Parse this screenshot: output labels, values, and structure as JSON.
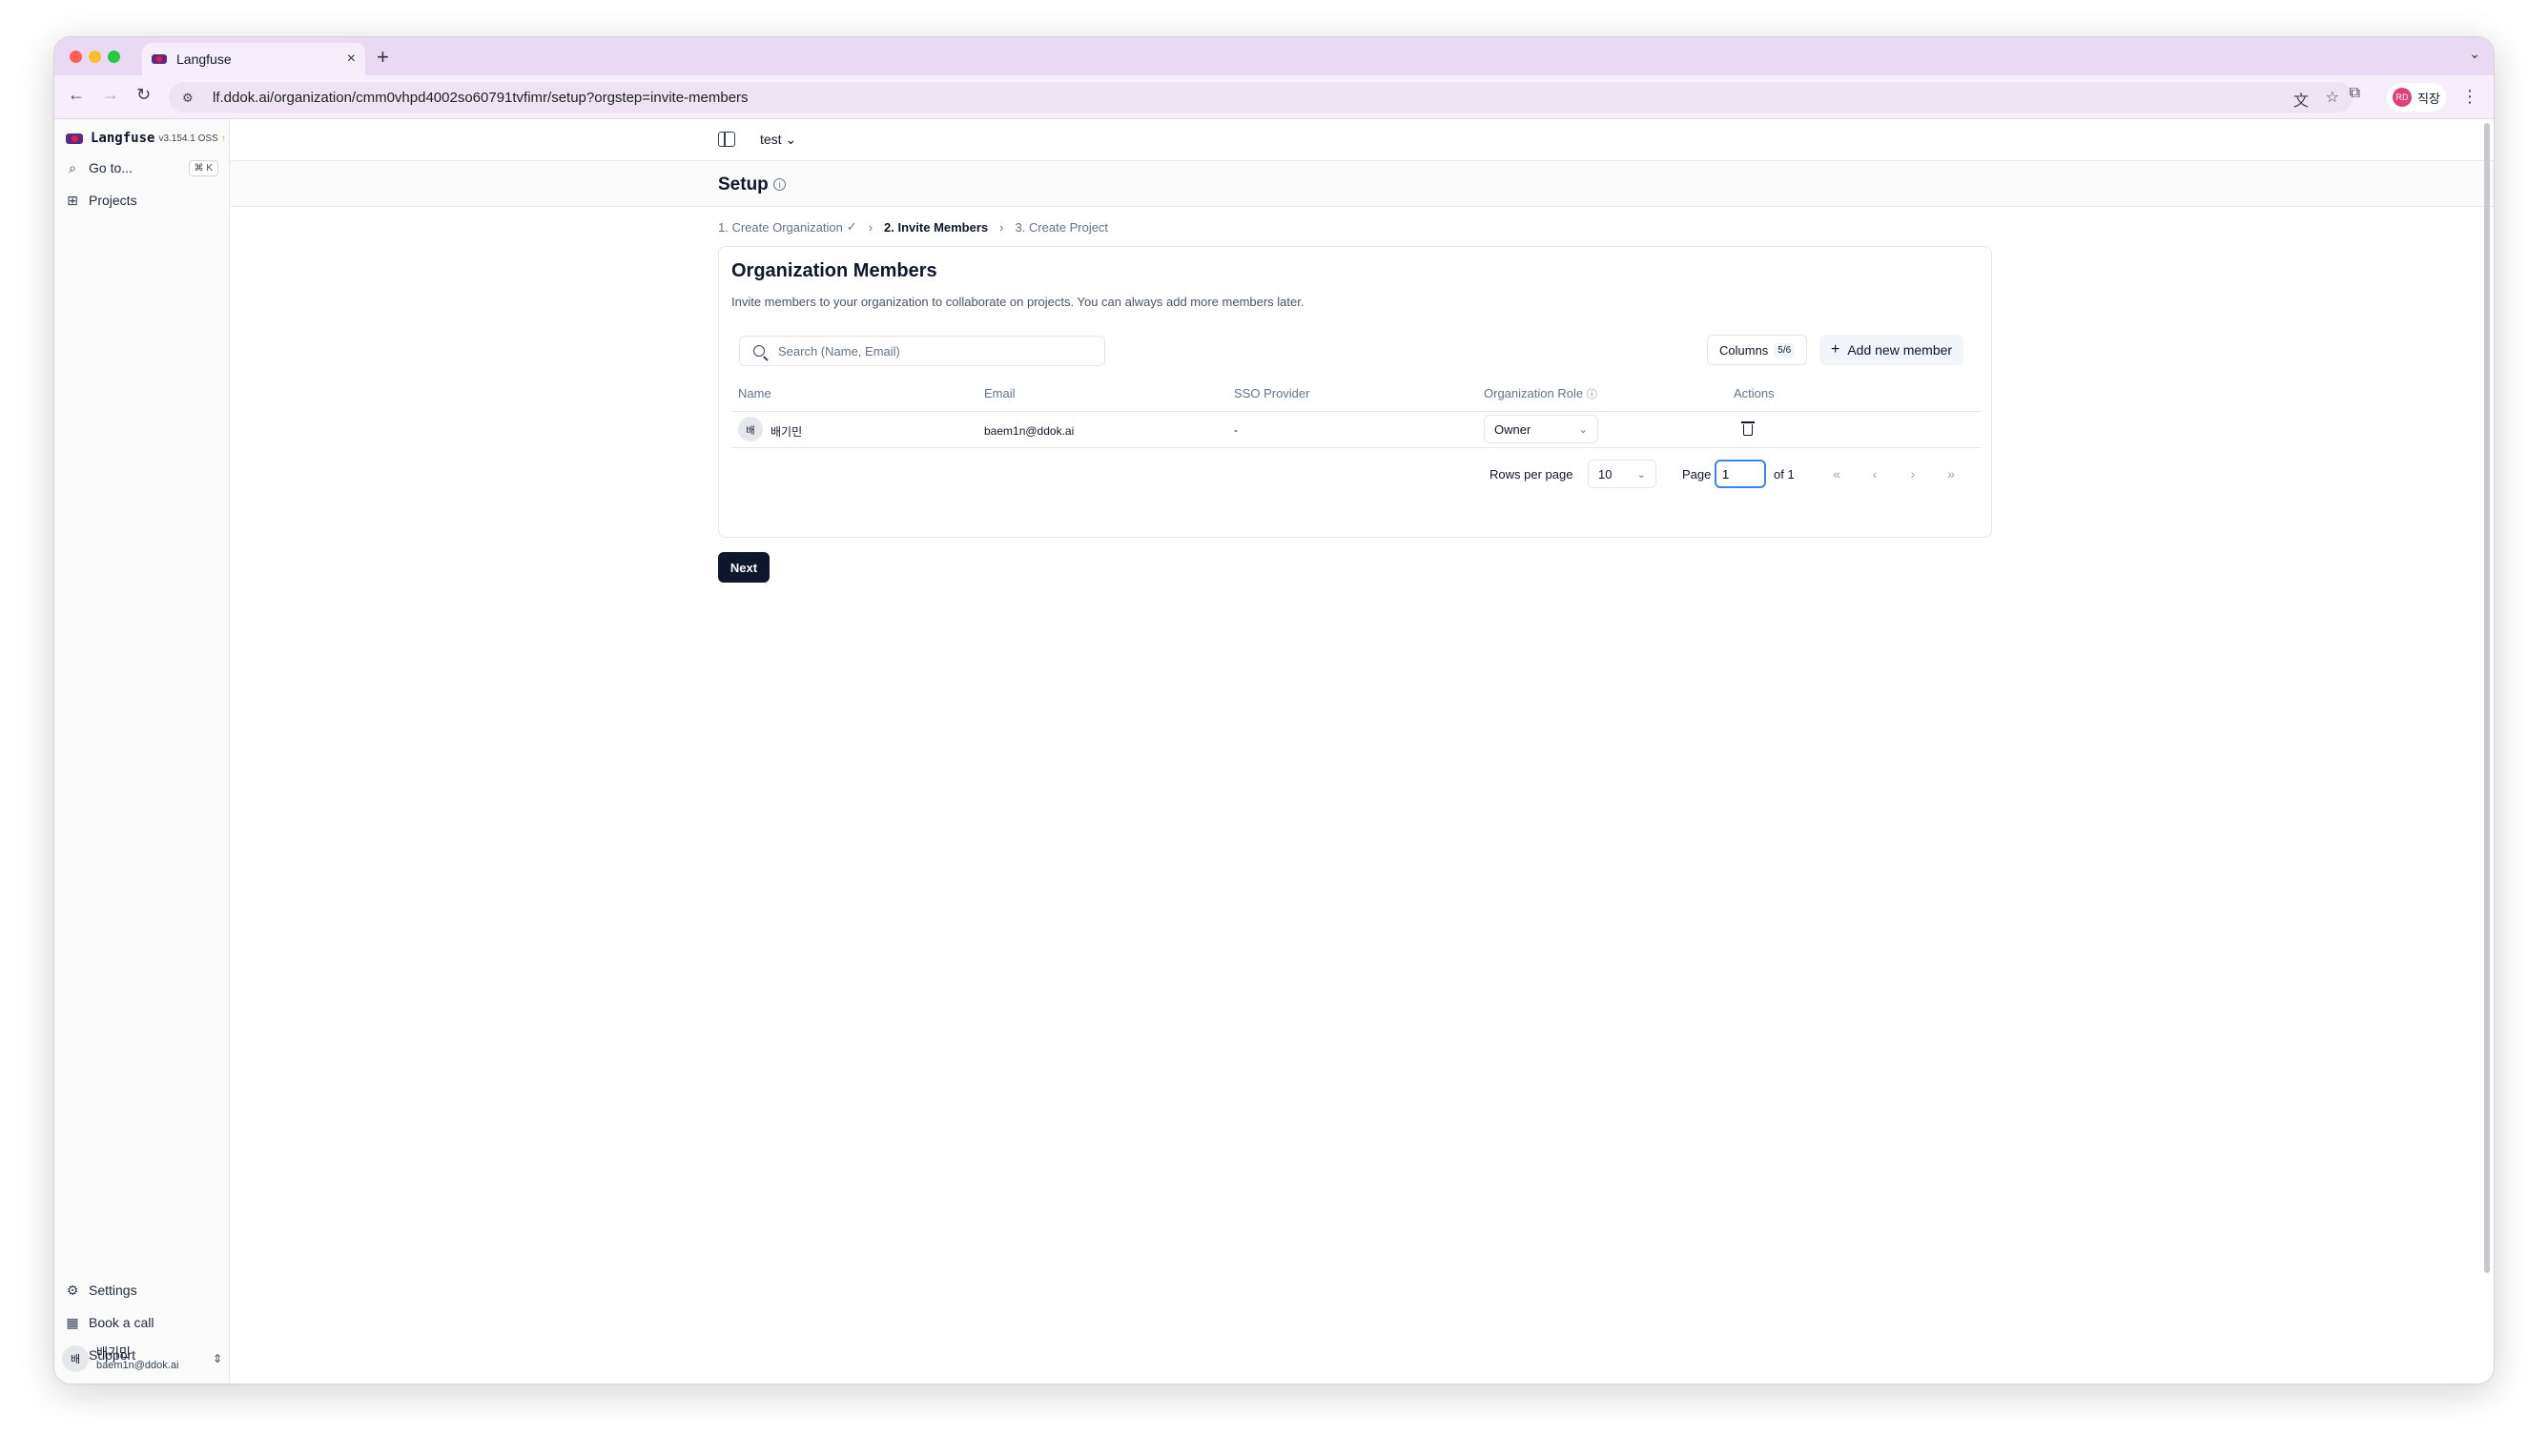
{
  "browser": {
    "tab_title": "Langfuse",
    "url": "lf.ddok.ai/organization/cmm0vhpd4002so60791tvfimr/setup?orgstep=invite-members",
    "profile_label": "직장",
    "profile_initials": "RD"
  },
  "sidebar": {
    "brand_name": "Langfuse",
    "version": "v3.154.1 OSS",
    "goto_label": "Go to...",
    "goto_shortcut": "⌘ K",
    "projects_label": "Projects",
    "settings_label": "Settings",
    "book_call_label": "Book a call",
    "support_label": "Support",
    "user_name": "배기민",
    "user_email": "baem1n@ddok.ai",
    "user_avatar": "배"
  },
  "topbar": {
    "project_name": "test"
  },
  "header": {
    "title": "Setup"
  },
  "steps": {
    "step1": "1. Create Organization",
    "step2": "2. Invite Members",
    "step3": "3. Create Project"
  },
  "card": {
    "title": "Organization Members",
    "description": "Invite members to your organization to collaborate on projects. You can always add more members later.",
    "search_placeholder": "Search (Name, Email)",
    "columns_label": "Columns",
    "columns_count": "5/6",
    "add_member_label": "Add new member"
  },
  "table": {
    "headers": [
      "Name",
      "Email",
      "SSO Provider",
      "Organization Role",
      "Actions"
    ],
    "rows": [
      {
        "avatar": "배",
        "name": "배기민",
        "email": "baem1n@ddok.ai",
        "sso": "-",
        "role": "Owner"
      }
    ]
  },
  "pagination": {
    "rows_per_page_label": "Rows per page",
    "rows_per_page_value": "10",
    "page_label": "Page",
    "page_value": "1",
    "of_label": "of 1"
  },
  "next_label": "Next"
}
